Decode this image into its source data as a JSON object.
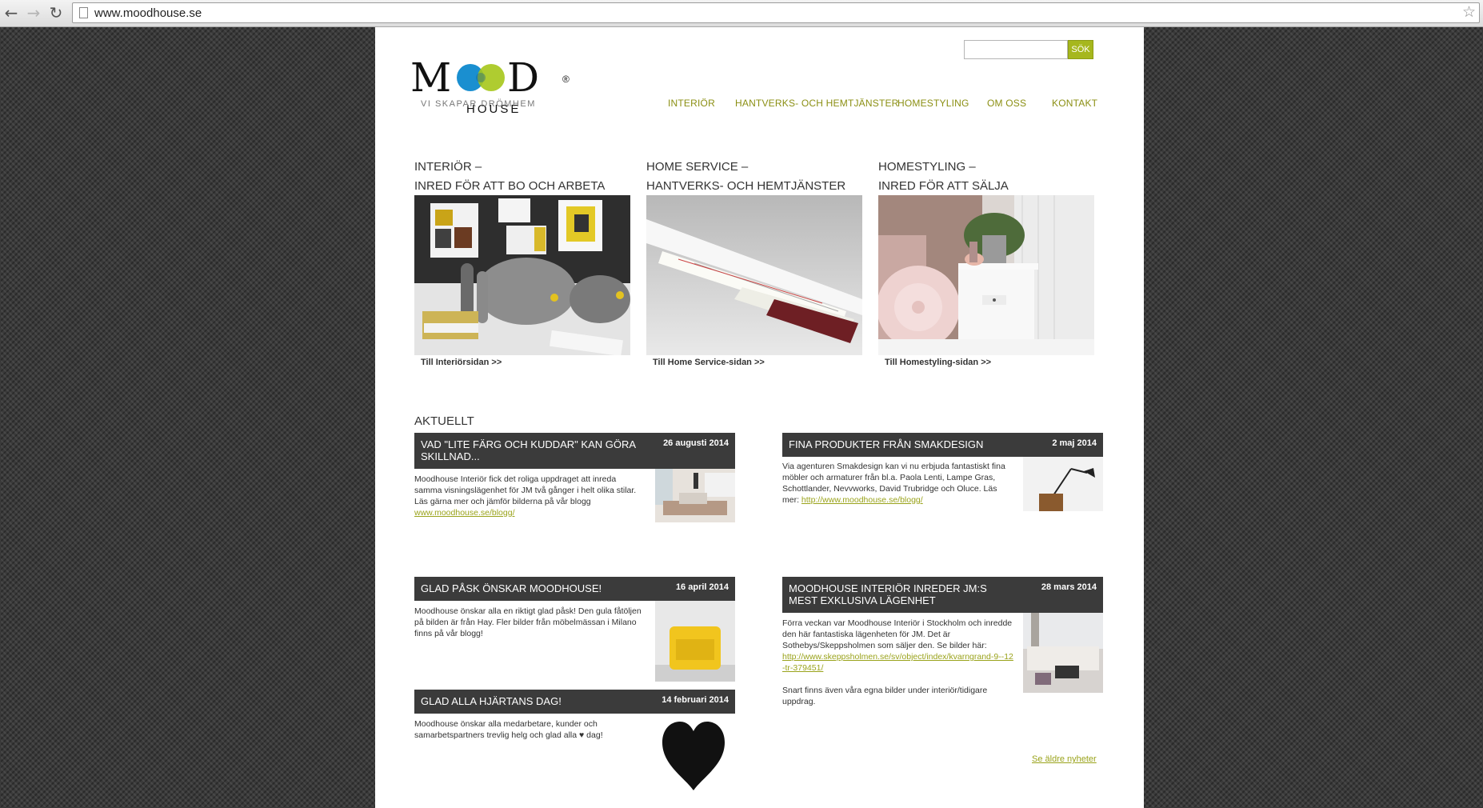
{
  "browser": {
    "back_icon": "arrow-left-icon",
    "forward_icon": "arrow-right-icon",
    "reload_icon": "reload-icon",
    "url": "www.moodhouse.se",
    "bookmark_icon": "star-icon"
  },
  "header": {
    "logo_text": "MOOD",
    "logo_sub": "HOUSE",
    "logo_reg": "®",
    "tagline": "VI SKAPAR DRÖMHEM",
    "search": {
      "placeholder": "",
      "button": "SÖK"
    },
    "nav": [
      "INTERIÖR",
      "HANTVERKS- OCH HEMTJÄNSTER",
      "HOMESTYLING",
      "OM OSS",
      "KONTAKT"
    ]
  },
  "columns": [
    {
      "title1": "INTERIÖR –",
      "title2": "INRED FÖR ATT BO OCH ARBETA",
      "link": "Till Interiörsidan >>"
    },
    {
      "title1": "HOME SERVICE –",
      "title2": "HANTVERKS- OCH HEMTJÄNSTER",
      "link": "Till Home Service-sidan >>"
    },
    {
      "title1": "HOMESTYLING –",
      "title2": "INRED FÖR ATT SÄLJA",
      "link": "Till Homestyling-sidan >>"
    }
  ],
  "news": {
    "heading": "AKTUELLT",
    "items": [
      {
        "title": "VAD \"LITE FÄRG OCH KUDDAR\" KAN GÖRA SKILLNAD...",
        "date": "26 augusti 2014",
        "body": "Moodhouse Interiör fick det roliga uppdraget att inreda samma visningslägenhet för JM två gånger i helt olika stilar. Läs gärna mer och jämför bilderna på vår blogg",
        "link": "www.moodhouse.se/blogg/"
      },
      {
        "title": "FINA PRODUKTER FRÅN SMAKDESIGN",
        "date": "2 maj 2014",
        "body": "Via agenturen Smakdesign kan vi nu erbjuda fantastiskt fina möbler och armaturer från bl.a. Paola Lenti, Lampe Gras, Schottlander, Nevvworks, David Trubridge och Oluce. Läs mer:",
        "link": "http://www.moodhouse.se/blogg/"
      },
      {
        "title": "GLAD PÅSK ÖNSKAR MOODHOUSE!",
        "date": "16 april 2014",
        "body": "Moodhouse önskar alla en riktigt glad påsk! Den gula fåtöljen på bilden är från Hay. Fler bilder från möbelmässan i Milano finns på vår blogg!"
      },
      {
        "title": "MOODHOUSE INTERIÖR INREDER JM:S MEST EXKLUSIVA LÄGENHET",
        "date": "28 mars 2014",
        "body": "Förra veckan var Moodhouse Interiör i Stockholm och inredde den här fantastiska lägenheten för JM. Det är Sothebys/Skeppsholmen som säljer den. Se bilder här:",
        "link": "http://www.skeppsholmen.se/sv/object/index/kvarngrand-9--12-tr-379451/",
        "body2": "Snart finns även våra egna bilder under interiör/tidigare uppdrag."
      },
      {
        "title": "GLAD ALLA HJÄRTANS DAG!",
        "date": "14 februari 2014",
        "body": "Moodhouse önskar alla medarbetare, kunder och samarbetspartners trevlig helg och glad alla ♥ dag!"
      }
    ],
    "older_link": "Se äldre nyheter"
  },
  "colors": {
    "accent": "#9aa31b",
    "logo_blue": "#1a8fd0",
    "logo_green": "#a6c619",
    "news_header_bg": "#3b3b3b"
  }
}
